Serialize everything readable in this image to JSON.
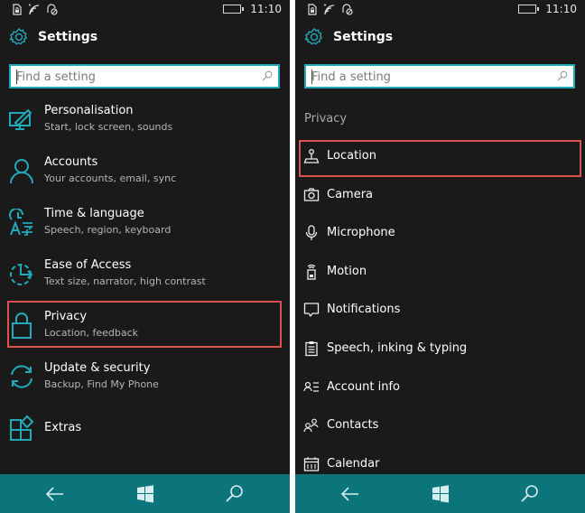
{
  "status_bar": {
    "time": "11:10"
  },
  "app": {
    "title": "Settings"
  },
  "search": {
    "placeholder": "Find a setting",
    "value": ""
  },
  "left_screen": {
    "categories": [
      {
        "name": "Personalisation",
        "description": "Start, lock screen, sounds",
        "icon": "personalisation-icon"
      },
      {
        "name": "Accounts",
        "description": "Your accounts, email, sync",
        "icon": "person-icon"
      },
      {
        "name": "Time & language",
        "description": "Speech, region, keyboard",
        "icon": "time-language-icon"
      },
      {
        "name": "Ease of Access",
        "description": "Text size, narrator, high contrast",
        "icon": "ease-of-access-icon"
      },
      {
        "name": "Privacy",
        "description": "Location, feedback",
        "icon": "lock-icon",
        "highlighted": true
      },
      {
        "name": "Update & security",
        "description": "Backup, Find My Phone",
        "icon": "update-icon"
      },
      {
        "name": "Extras",
        "description": "",
        "icon": "extras-icon"
      }
    ]
  },
  "right_screen": {
    "section": "Privacy",
    "items": [
      {
        "name": "Location",
        "icon": "location-icon",
        "highlighted": true
      },
      {
        "name": "Camera",
        "icon": "camera-icon"
      },
      {
        "name": "Microphone",
        "icon": "microphone-icon"
      },
      {
        "name": "Motion",
        "icon": "motion-icon"
      },
      {
        "name": "Notifications",
        "icon": "notification-icon"
      },
      {
        "name": "Speech, inking & typing",
        "icon": "speech-icon"
      },
      {
        "name": "Account info",
        "icon": "account-info-icon"
      },
      {
        "name": "Contacts",
        "icon": "contacts-icon"
      },
      {
        "name": "Calendar",
        "icon": "calendar-icon"
      }
    ]
  },
  "navbar": {
    "buttons": [
      "back",
      "start",
      "search"
    ]
  },
  "colors": {
    "accent": "#22aab8",
    "navbar": "#0c747b",
    "highlight": "#d9534f",
    "background": "#1a1a1a"
  }
}
